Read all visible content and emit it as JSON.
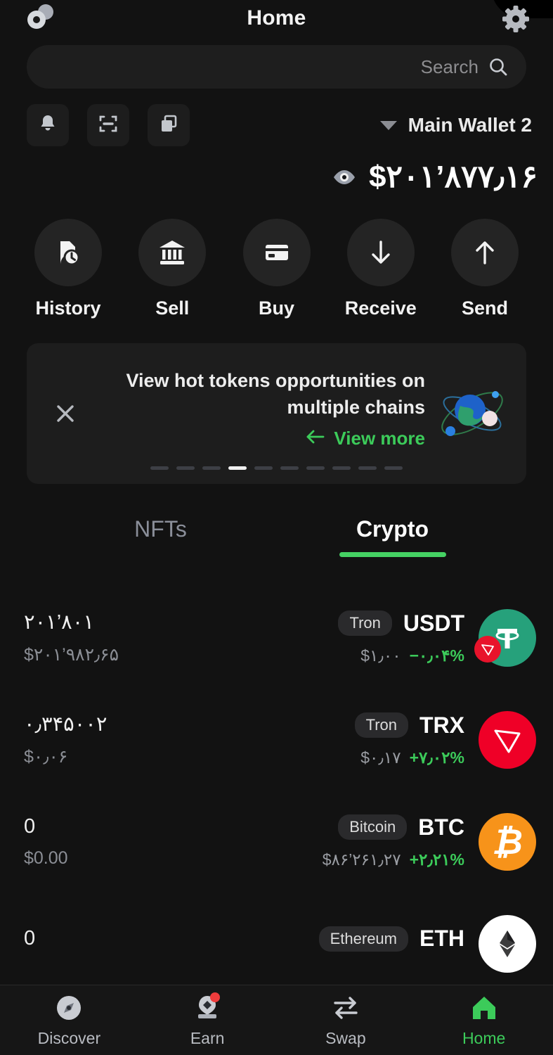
{
  "header": {
    "title": "Home",
    "logo_icon": "dual-circle-logo-icon",
    "settings_icon": "gear-icon"
  },
  "search": {
    "placeholder": "Search",
    "value": "",
    "icon": "search-icon"
  },
  "quick_actions": [
    {
      "name": "notifications",
      "icon": "bell-icon"
    },
    {
      "name": "scan",
      "icon": "qr-scan-icon"
    },
    {
      "name": "copy-address",
      "icon": "copy-icon"
    }
  ],
  "wallet": {
    "name": "Main Wallet 2",
    "caret_icon": "chevron-down-icon",
    "balance": "$۲۰۱’۸۷۷٫۱۶",
    "visibility_icon": "eye-icon"
  },
  "actions": [
    {
      "label": "History",
      "icon": "history-icon"
    },
    {
      "label": "Sell",
      "icon": "bank-icon"
    },
    {
      "label": "Buy",
      "icon": "card-icon"
    },
    {
      "label": "Receive",
      "icon": "arrow-down-icon"
    },
    {
      "label": "Send",
      "icon": "arrow-up-icon"
    }
  ],
  "promo": {
    "close_icon": "close-icon",
    "text": "View hot tokens opportunities on multiple chains",
    "cta_label": "View more",
    "cta_icon": "arrow-left-icon",
    "art_icon": "planet-orbit-icon",
    "dots_total": 10,
    "dots_active_index": 3
  },
  "tabs": [
    {
      "label": "NFTs",
      "active": false
    },
    {
      "label": "Crypto",
      "active": true
    }
  ],
  "tokens": [
    {
      "amount": "۲۰۱’۸۰۱",
      "value": "$۲۰۱’۹۸۲٫۶۵",
      "chain": "Tron",
      "symbol": "USDT",
      "price": "$۱٫۰۰",
      "change": "−۰٫۰۴%",
      "change_color": "#3ccb5a",
      "icon_color": "#26a17b",
      "icon_glyph": "₮",
      "icon_name": "usdt-icon",
      "sub_badge_color": "#e8132b",
      "sub_badge_name": "tron-chain-badge"
    },
    {
      "amount": "۰٫۳۴۵۰۰۲",
      "value": "$۰٫۰۶",
      "chain": "Tron",
      "symbol": "TRX",
      "price": "$۰٫۱۷",
      "change": "+۷٫۰۲%",
      "change_color": "#3ccb5a",
      "icon_color": "#ef0027",
      "icon_glyph": "",
      "icon_name": "trx-icon",
      "sub_badge_color": "",
      "sub_badge_name": ""
    },
    {
      "amount": "0",
      "value": "$0.00",
      "chain": "Bitcoin",
      "symbol": "BTC",
      "price": "$۸۶’۲۶۱٫۲۷",
      "change": "+۲٫۲۱%",
      "change_color": "#3ccb5a",
      "icon_color": "#f7931a",
      "icon_glyph": "₿",
      "icon_name": "btc-icon",
      "sub_badge_color": "",
      "sub_badge_name": ""
    },
    {
      "amount": "0",
      "value": "",
      "chain": "Ethereum",
      "symbol": "ETH",
      "price": "",
      "change": "",
      "change_color": "#3ccb5a",
      "icon_color": "#ffffff",
      "icon_glyph": "",
      "icon_name": "eth-icon",
      "sub_badge_color": "",
      "sub_badge_name": ""
    }
  ],
  "bottom_nav": [
    {
      "label": "Discover",
      "icon": "compass-icon",
      "active": false,
      "badge": false
    },
    {
      "label": "Earn",
      "icon": "earn-icon",
      "active": false,
      "badge": true
    },
    {
      "label": "Swap",
      "icon": "swap-icon",
      "active": false,
      "badge": false
    },
    {
      "label": "Home",
      "icon": "home-icon",
      "active": true,
      "badge": false
    }
  ],
  "colors": {
    "accent_green": "#3ccb5a",
    "background": "#121212",
    "surface": "#1d1d1d"
  }
}
